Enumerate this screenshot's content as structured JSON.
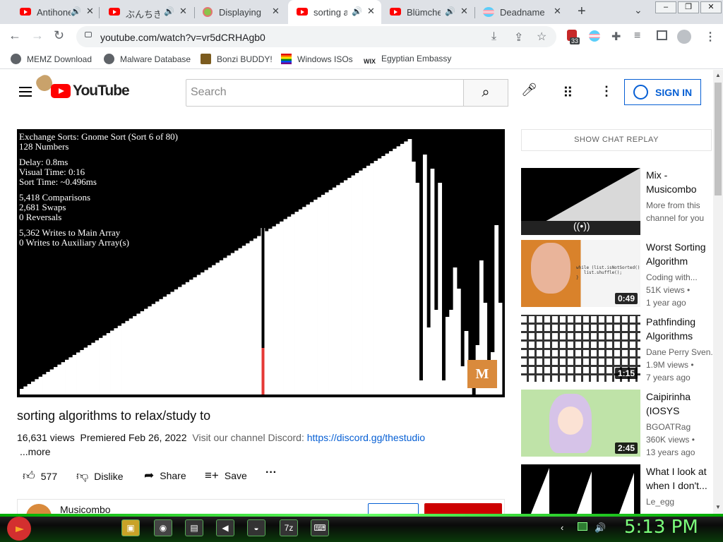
{
  "tabs": [
    {
      "label": "Antihone",
      "audio": true,
      "active": false
    },
    {
      "label": "ぶんちき",
      "audio": true,
      "active": false
    },
    {
      "label": "Displaying C",
      "audio": false,
      "active": false
    },
    {
      "label": "sorting a",
      "audio": true,
      "active": true
    },
    {
      "label": "Blümche",
      "audio": true,
      "active": false
    },
    {
      "label": "Deadname R",
      "audio": false,
      "active": false
    }
  ],
  "new_tab_label": "+",
  "toolbar": {
    "url": "youtube.com/watch?v=vr5dCRHAgb0",
    "badge_count": "33"
  },
  "bookmarks": [
    "MEMZ Download",
    "Malware Database",
    "Bonzi BUDDY!",
    "Windows ISOs",
    "Egyptian Embassy"
  ],
  "youtube": {
    "logo_text": "YouTube",
    "search_placeholder": "Search",
    "signin_label": "SIGN IN"
  },
  "video": {
    "overlay": {
      "line1": "Exchange Sorts: Gnome Sort (Sort 6 of 80)",
      "line2": "128 Numbers",
      "line3": "Delay: 0.8ms",
      "line4": "Visual Time: 0:16",
      "line5": "Sort Time: ~0.496ms",
      "line6": "5,418 Comparisons",
      "line7": "2,681 Swaps",
      "line8": "0 Reversals",
      "line9": "5,362 Writes to Main Array",
      "line10": "0 Writes to Auxiliary Array(s)"
    },
    "watermark": "M",
    "title": "sorting algorithms to relax/study to",
    "views": "16,631 views",
    "premiered": "Premiered Feb 26, 2022",
    "description": "Visit our channel Discord:",
    "discord_link": "https://discord.gg/thestudio",
    "more_label": "...more",
    "likes": "577",
    "dislike_label": "Dislike",
    "share_label": "Share",
    "save_label": "Save",
    "channel_name": "Musicombo"
  },
  "sidebar": {
    "chat_replay_label": "SHOW CHAT REPLAY",
    "recommendations": [
      {
        "title": "Mix - Musicombo",
        "line1": "More from this",
        "line2": "channel for you",
        "line3": "",
        "duration": ""
      },
      {
        "title": "Worst Sorting Algorithm Eve...",
        "line1": "Coding with...",
        "line2": "51K views •",
        "line3": "1 year ago",
        "duration": "0:49"
      },
      {
        "title": "Pathfinding Algorithms",
        "line1": "Dane Perry Sven...",
        "line2": "1.9M views •",
        "line3": "7 years ago",
        "duration": "1:15"
      },
      {
        "title": "Caipirinha (IOSYS Remix)",
        "line1": "BGOATRag",
        "line2": "360K views •",
        "line3": "13 years ago",
        "duration": "2:45"
      },
      {
        "title": "What I look at when I don't...",
        "line1": "Le_egg",
        "line2": "",
        "line3": "",
        "duration": ""
      }
    ]
  },
  "taskbar": {
    "clock": "5:13 PM"
  },
  "colors": {
    "youtube_red": "#ff0000",
    "link_blue": "#065fd4",
    "clock_green": "#7cff7c"
  }
}
